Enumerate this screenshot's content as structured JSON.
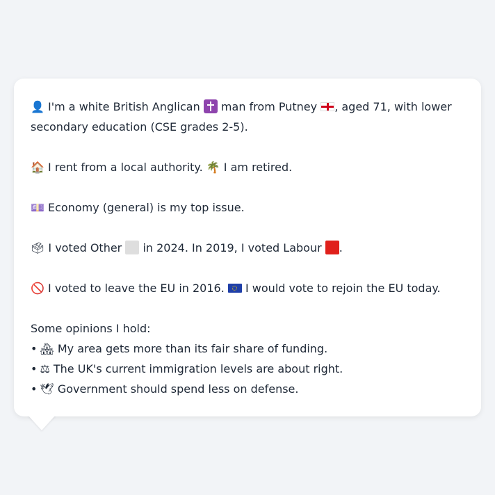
{
  "identity": {
    "icon": "person-silhouette-icon",
    "text_before_religion": "I'm a white British Anglican",
    "religion_icon": "latin-cross-icon",
    "text_after_religion": "man from Putney",
    "flag_icon": "england-flag-icon",
    "text_after_flag": ", aged 71, with lower secondary education (CSE grades 2-5)."
  },
  "housing": {
    "icon": "house-icon",
    "text": "I rent from a local authority.",
    "work_icon": "palm-tree-icon",
    "work_text": "I am retired."
  },
  "issue": {
    "icon": "money-notes-icon",
    "text": "Economy (general) is my top issue."
  },
  "vote": {
    "icon": "ballot-box-icon",
    "text_2024_before": "I voted Other",
    "party_2024_color": "#dedede",
    "text_2024_after": "in 2024. In 2019, I voted Labour",
    "party_2019_color": "#e0201b",
    "end": "."
  },
  "eu": {
    "icon": "prohibited-icon",
    "text_2016": "I voted to leave the EU in 2016.",
    "flag_icon": "eu-flag-icon",
    "text_today": "I would vote to rejoin the EU today."
  },
  "opinions": {
    "heading": "Some opinions I hold:",
    "items": [
      {
        "icon": "houses-icon",
        "text": "My area gets more than its fair share of funding."
      },
      {
        "icon": "scales-icon",
        "text": "The UK's current immigration levels are about right."
      },
      {
        "icon": "dove-icon",
        "text": "Government should spend less on defense."
      }
    ]
  }
}
